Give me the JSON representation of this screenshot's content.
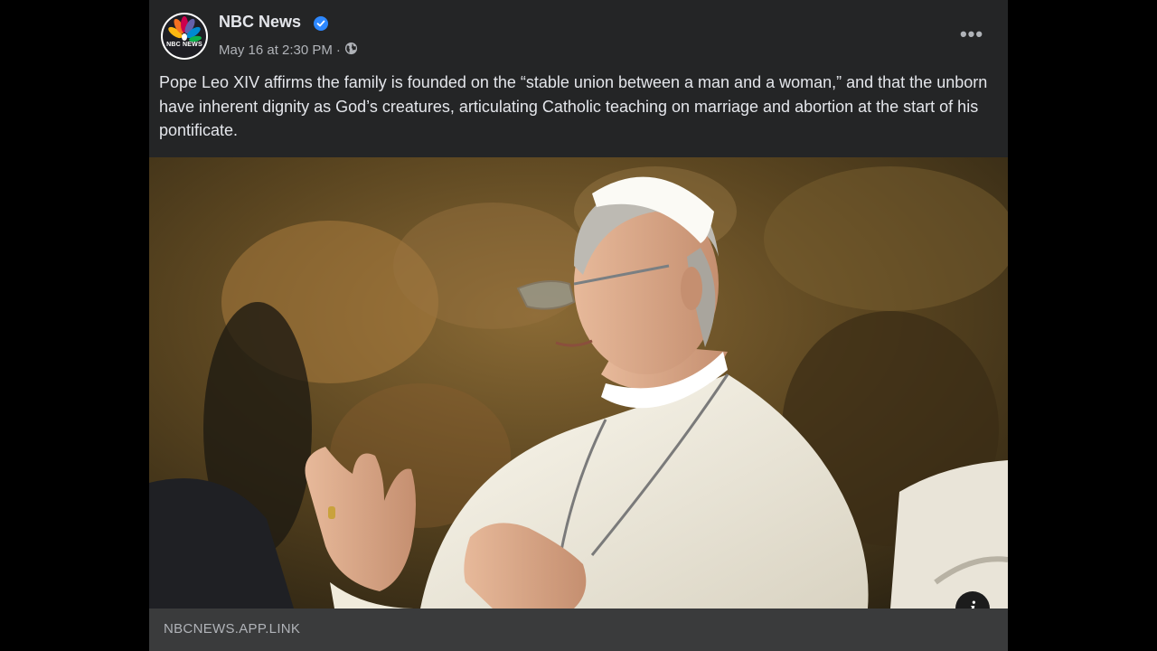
{
  "post": {
    "page_name": "NBC News",
    "avatar_wordmark": "NBC NEWS",
    "verified_icon": "verified-badge-icon",
    "timestamp": "May 16 at 2:30 PM",
    "separator": "·",
    "audience_icon": "globe-icon",
    "more_icon": "more-options-icon",
    "more_label": "•••",
    "caption": "Pope Leo XIV affirms the family is founded on the “stable union between a man and a woman,” and that the unborn have inherent dignity as God’s creatures, articulating Catholic teaching on marriage and abortion at the start of his pontificate."
  },
  "photo": {
    "info_label": "i",
    "info_icon": "info-icon"
  },
  "link": {
    "domain": "NBCNEWS.APP.LINK"
  },
  "colors": {
    "post_bg": "#242526",
    "link_bar_bg": "#3a3b3c",
    "primary_text": "#e4e6eb",
    "secondary_text": "#b0b3b8",
    "verified_blue": "#2d88ff"
  }
}
